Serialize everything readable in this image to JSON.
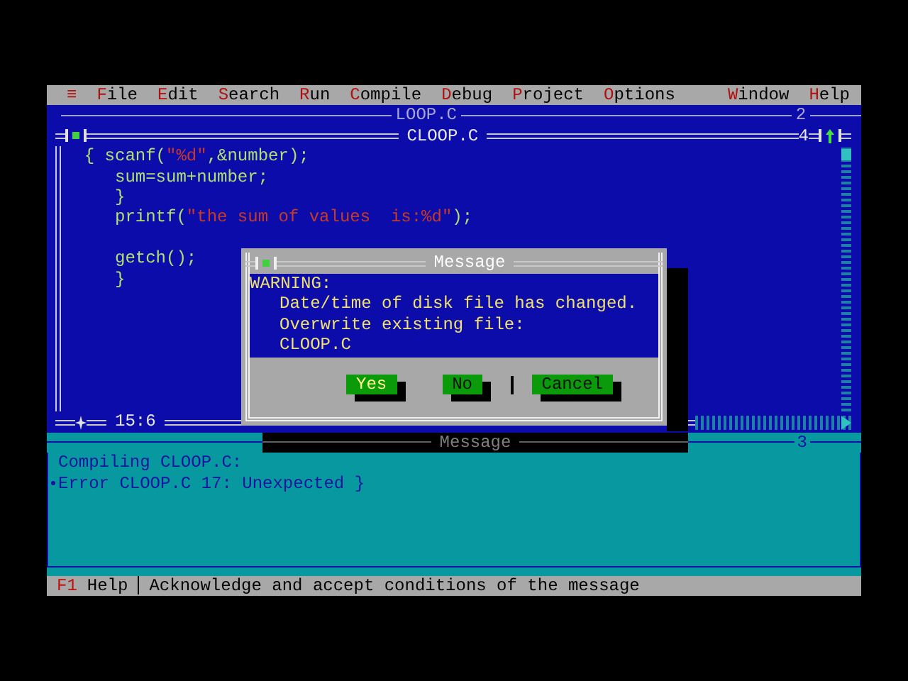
{
  "menu": {
    "left": [
      {
        "hotkey": "≡"
      },
      {
        "hotkey": "F",
        "rest": "ile"
      },
      {
        "hotkey": "E",
        "rest": "dit"
      },
      {
        "hotkey": "S",
        "rest": "earch"
      },
      {
        "hotkey": "R",
        "rest": "un"
      },
      {
        "hotkey": "C",
        "rest": "ompile"
      },
      {
        "hotkey": "D",
        "rest": "ebug"
      },
      {
        "hotkey": "P",
        "rest": "roject"
      },
      {
        "hotkey": "O",
        "rest": "ptions"
      }
    ],
    "right": [
      {
        "hotkey": "W",
        "rest": "indow"
      },
      {
        "hotkey": "H",
        "rest": "elp"
      }
    ]
  },
  "background_window": {
    "title": "LOOP.C",
    "number": "2"
  },
  "editor": {
    "title": "CLOOP.C",
    "number": "4",
    "cursor_position": "15:6",
    "lines": [
      {
        "kind": "code",
        "segments": [
          {
            "text": "  { scanf(",
            "kind": "code"
          },
          {
            "text": "\"%d\"",
            "kind": "string"
          },
          {
            "text": ",&number);",
            "kind": "code"
          }
        ]
      },
      {
        "kind": "code",
        "segments": [
          {
            "text": "     sum=sum+number;",
            "kind": "code"
          }
        ]
      },
      {
        "kind": "code",
        "segments": [
          {
            "text": "     }",
            "kind": "code"
          }
        ]
      },
      {
        "kind": "code",
        "segments": [
          {
            "text": "     printf(",
            "kind": "code"
          },
          {
            "text": "\"the sum of values  is:%d\"",
            "kind": "string"
          },
          {
            "text": ");",
            "kind": "code"
          }
        ]
      },
      {
        "kind": "blank"
      },
      {
        "kind": "code",
        "segments": [
          {
            "text": "     getch();",
            "kind": "code"
          }
        ]
      },
      {
        "kind": "code",
        "segments": [
          {
            "text": "     }",
            "kind": "code"
          }
        ]
      }
    ]
  },
  "dialog": {
    "title": "Message",
    "heading": "WARNING:",
    "lines": [
      "Date/time of disk file has changed.",
      "Overwrite existing file:",
      "CLOOP.C"
    ],
    "buttons": [
      {
        "label": "Yes",
        "selected": true
      },
      {
        "label": "No",
        "selected": false
      },
      {
        "label": "Cancel",
        "selected": false
      }
    ]
  },
  "message_pane": {
    "title": "Message",
    "number": "3",
    "lines": [
      {
        "text": "Compiling CLOOP.C:",
        "current": false
      },
      {
        "text": "Error CLOOP.C 17: Unexpected }",
        "current": true
      }
    ]
  },
  "status_bar": {
    "key": "F1",
    "key_label": "Help",
    "hint": "Acknowledge and accept conditions of the message"
  }
}
